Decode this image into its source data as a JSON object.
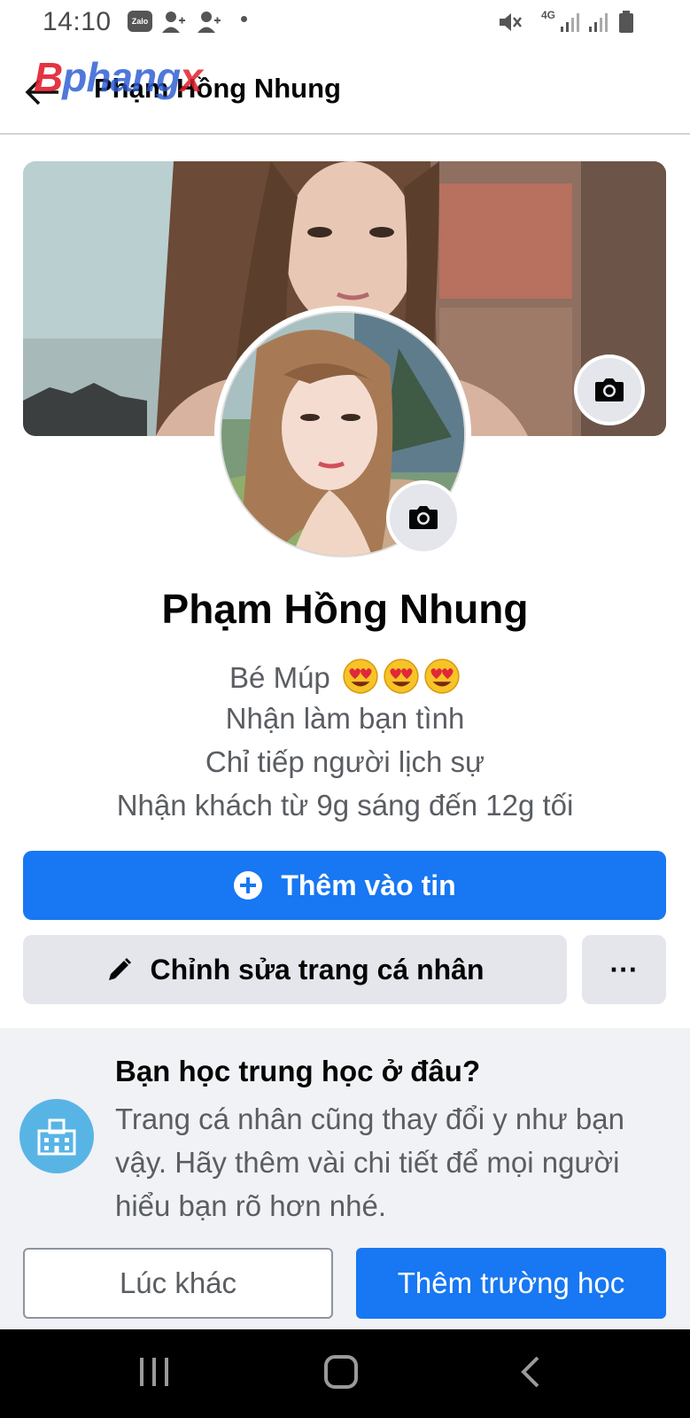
{
  "status_bar": {
    "time": "14:10",
    "zalo_label": "Zalo",
    "network_type": "4G",
    "icons": [
      "zalo-icon",
      "add-friend-icon",
      "add-friend-icon",
      "dot-icon",
      "mute-icon",
      "network-4g-icon",
      "signal-icon",
      "signal-icon",
      "battery-icon"
    ]
  },
  "header": {
    "title": "Phạm Hồng Nhung",
    "back_icon": "back-arrow-icon",
    "watermark": {
      "part1": "B",
      "part2": "phang",
      "part3": "x"
    }
  },
  "profile": {
    "name": "Phạm Hồng Nhung",
    "bio_line_1": "Bé Múp",
    "bio_line_1_emojis": [
      "heart-eyes-emoji",
      "heart-eyes-emoji",
      "heart-eyes-emoji"
    ],
    "bio_line_2": "Nhận làm bạn tình",
    "bio_line_3": "Chỉ tiếp người lịch sự",
    "bio_line_4": "Nhận khách từ 9g sáng đến 12g tối"
  },
  "actions": {
    "add_story_label": "Thêm vào tin",
    "edit_profile_label": "Chỉnh sửa trang cá nhân",
    "more_label": "···"
  },
  "school_prompt": {
    "title": "Bạn học trung học ở đâu?",
    "description": "Trang cá nhân cũng thay đổi y như bạn vậy. Hãy thêm vài chi tiết để mọi người hiểu bạn rõ hơn nhé.",
    "later_label": "Lúc khác",
    "add_school_label": "Thêm trường học"
  },
  "colors": {
    "primary": "#1877f2",
    "secondary_button": "#e4e6eb",
    "card_background": "#f0f2f5",
    "school_icon": "#59b4e6"
  }
}
